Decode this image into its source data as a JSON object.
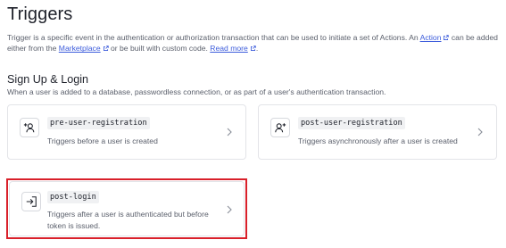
{
  "page": {
    "title": "Triggers"
  },
  "intro": {
    "part1": "Trigger is a specific event in the authentication or authorization transaction that can be used to initiate a set of Actions. An ",
    "action_link": "Action",
    "part2": " can be added either from the ",
    "marketplace_link": "Marketplace",
    "part3": " or be built with custom code. ",
    "read_more_link": "Read more",
    "part4": "."
  },
  "section": {
    "title": "Sign Up & Login",
    "description": "When a user is added to a database, passwordless connection, or as part of a user's authentication transaction."
  },
  "triggers": [
    {
      "name": "pre-user-registration",
      "description": "Triggers before a user is created",
      "icon": "user-plus-icon"
    },
    {
      "name": "post-user-registration",
      "description": "Triggers asynchronously after a user is created",
      "icon": "user-plus-icon"
    },
    {
      "name": "post-login",
      "description_line1": "Triggers after a user is authenticated but before",
      "description_line2": "token is issued.",
      "icon": "login-arrow-icon"
    }
  ],
  "colors": {
    "link": "#3b5bdb",
    "highlight": "#d9202a",
    "border": "#e3e4e8"
  }
}
